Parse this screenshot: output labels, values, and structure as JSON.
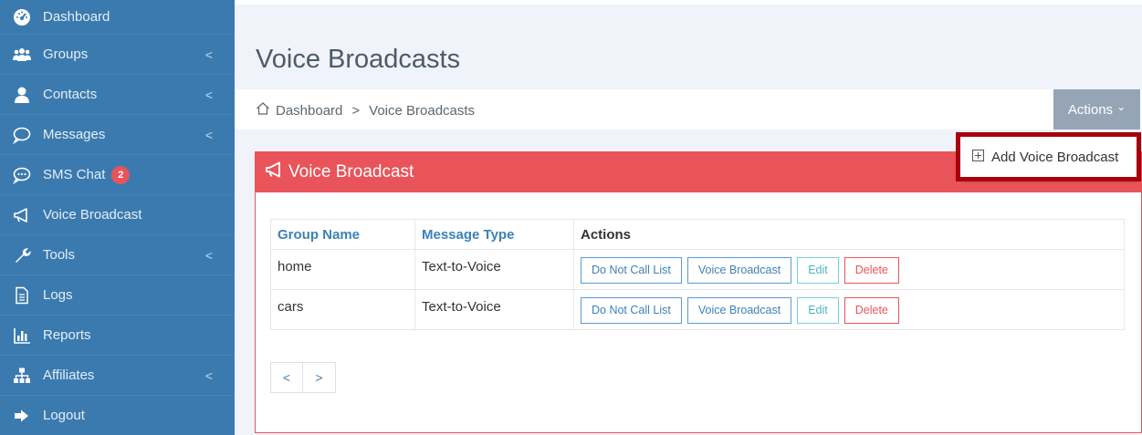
{
  "sidebar": {
    "items": [
      {
        "label": "Dashboard",
        "icon": "dashboard-icon",
        "chevron": ""
      },
      {
        "label": "Groups",
        "icon": "users-icon",
        "chevron": "<"
      },
      {
        "label": "Contacts",
        "icon": "user-icon",
        "chevron": "<"
      },
      {
        "label": "Messages",
        "icon": "chat-bubble-icon",
        "chevron": "<"
      },
      {
        "label": "SMS Chat",
        "icon": "sms-icon",
        "chevron": "",
        "badge": "2"
      },
      {
        "label": "Voice Broadcast",
        "icon": "megaphone-icon",
        "chevron": ""
      },
      {
        "label": "Tools",
        "icon": "wrench-icon",
        "chevron": "<"
      },
      {
        "label": "Logs",
        "icon": "document-icon",
        "chevron": ""
      },
      {
        "label": "Reports",
        "icon": "bar-chart-icon",
        "chevron": ""
      },
      {
        "label": "Affiliates",
        "icon": "sitemap-icon",
        "chevron": "<"
      },
      {
        "label": "Logout",
        "icon": "logout-icon",
        "chevron": ""
      }
    ]
  },
  "page": {
    "title": "Voice Broadcasts"
  },
  "breadcrumb": {
    "home": "Dashboard",
    "separator": ">",
    "current": "Voice Broadcasts"
  },
  "actions": {
    "label": "Actions",
    "chevron": "⌄"
  },
  "dropdown": {
    "item": "Add Voice Broadcast"
  },
  "portlet": {
    "title": "Voice Broadcast"
  },
  "table": {
    "headers": [
      "Group Name",
      "Message Type",
      "Actions"
    ],
    "rows": [
      {
        "group": "home",
        "type": "Text-to-Voice"
      },
      {
        "group": "cars",
        "type": "Text-to-Voice"
      }
    ],
    "buttons": {
      "dnc": "Do Not Call List",
      "vb": "Voice Broadcast",
      "edit": "Edit",
      "delete": "Delete"
    }
  },
  "pager": {
    "prev": "<",
    "next": ">"
  },
  "colors": {
    "sidebar": "#3b7aaf",
    "accent": "#e8545a",
    "link": "#3c82b8",
    "highlight": "#a8000a"
  }
}
